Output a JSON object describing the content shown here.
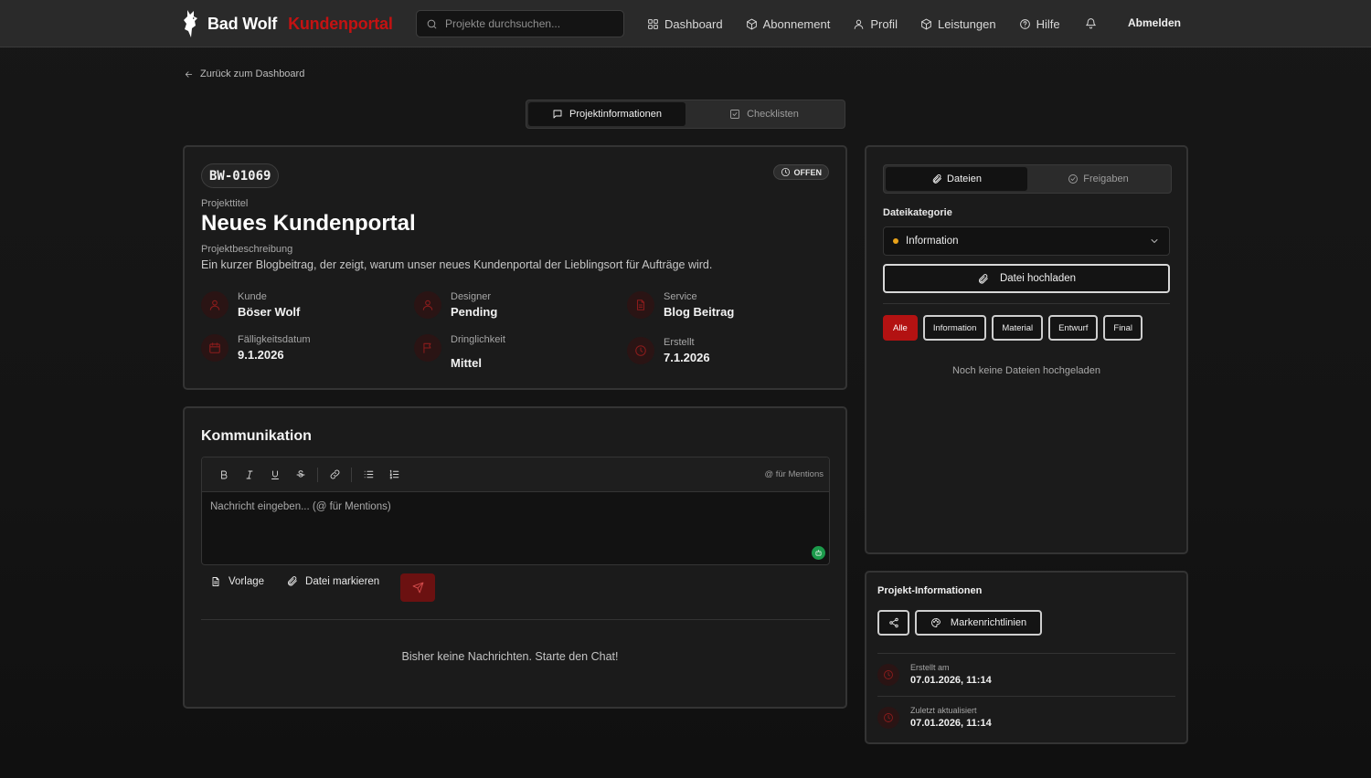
{
  "header": {
    "brand_name": "Bad Wolf",
    "brand_accent": "Kundenportal",
    "search_placeholder": "Projekte durchsuchen...",
    "nav": [
      {
        "label": "Dashboard",
        "icon": "grid-icon"
      },
      {
        "label": "Abonnement",
        "icon": "package-icon"
      },
      {
        "label": "Profil",
        "icon": "user-icon"
      },
      {
        "label": "Leistungen",
        "icon": "box-icon"
      },
      {
        "label": "Hilfe",
        "icon": "help-circle-icon"
      }
    ],
    "logout_label": "Abmelden"
  },
  "back_link": "Zurück zum Dashboard",
  "main_tabs": {
    "info": "Projektinformationen",
    "checklists": "Checklisten"
  },
  "project": {
    "id": "BW-01069",
    "status": "OFFEN",
    "title_label": "Projekttitel",
    "title": "Neues Kundenportal",
    "description_label": "Projektbeschreibung",
    "description": "Ein kurzer Blogbeitrag, der zeigt, warum unser neues Kundenportal der Lieblingsort für Aufträge wird.",
    "meta": {
      "customer_label": "Kunde",
      "customer": "Böser Wolf",
      "designer_label": "Designer",
      "designer": "Pending",
      "service_label": "Service",
      "service": "Blog Beitrag",
      "due_label": "Fälligkeitsdatum",
      "due": "9.1.2026",
      "priority_label": "Dringlichkeit",
      "priority": "Mittel",
      "created_label": "Erstellt",
      "created": "7.1.2026"
    }
  },
  "communication": {
    "title": "Kommunikation",
    "mention_hint": "@ für Mentions",
    "placeholder": "Nachricht eingeben... (@ für Mentions)",
    "template_label": "Vorlage",
    "mark_file_label": "Datei markieren",
    "empty": "Bisher keine Nachrichten. Starte den Chat!"
  },
  "files": {
    "tab_files": "Dateien",
    "tab_approvals": "Freigaben",
    "category_label": "Dateikategorie",
    "category_value": "Information",
    "category_dot_color": "#e8a21a",
    "upload_label": "Datei hochladen",
    "filters": [
      "Alle",
      "Information",
      "Material",
      "Entwurf",
      "Final"
    ],
    "empty": "Noch keine Dateien hochgeladen"
  },
  "project_info": {
    "title": "Projekt-Informationen",
    "brand_guidelines": "Markenrichtlinien",
    "created_label": "Erstellt am",
    "created": "07.01.2026, 11:14",
    "updated_label": "Zuletzt aktualisiert",
    "updated": "07.01.2026, 11:14"
  },
  "colors": {
    "accent": "#c41212",
    "background": "#141414",
    "card": "#1b1b1b"
  }
}
